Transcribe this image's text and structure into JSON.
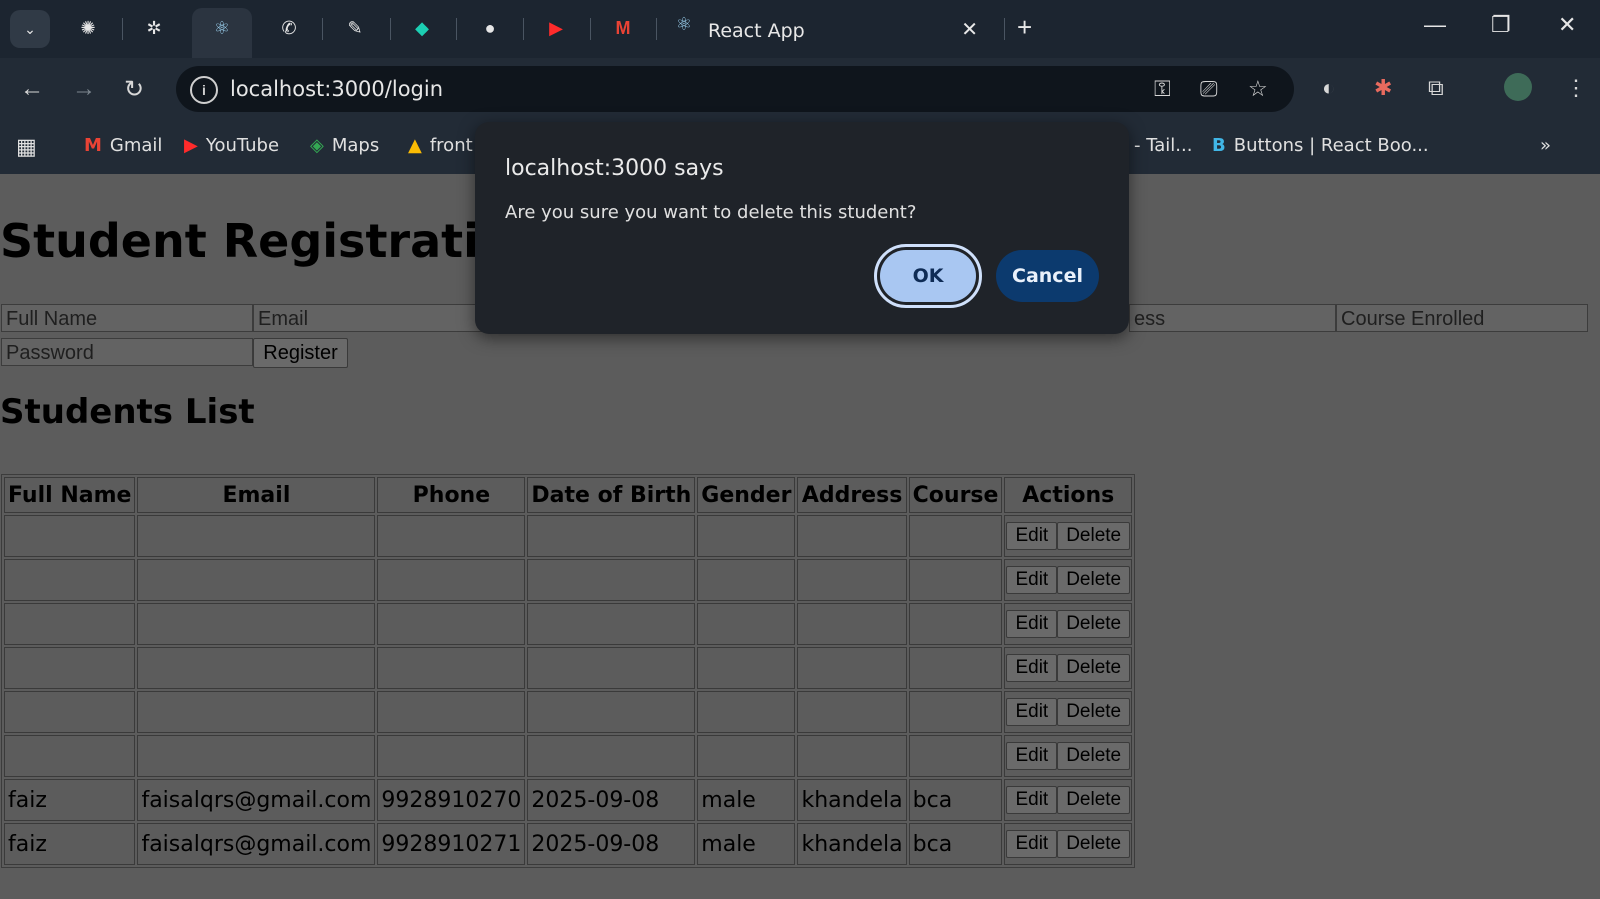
{
  "browser": {
    "active_tab_title": "React App",
    "url": "localhost:3000/login",
    "bookmarks": [
      "Gmail",
      "YouTube",
      "Maps",
      "front",
      "- Tail...",
      "Buttons | React Boo..."
    ]
  },
  "page": {
    "title": "Student Registration",
    "form": {
      "full_name_placeholder": "Full Name",
      "email_placeholder": "Email",
      "address_placeholder": "ess",
      "course_placeholder": "Course Enrolled",
      "password_placeholder": "Password",
      "register_label": "Register"
    },
    "list_title": "Students List",
    "table": {
      "headers": [
        "Full Name",
        "Email",
        "Phone",
        "Date of Birth",
        "Gender",
        "Address",
        "Course",
        "Actions"
      ],
      "rows": [
        [
          "",
          "",
          "",
          "",
          "",
          "",
          ""
        ],
        [
          "",
          "",
          "",
          "",
          "",
          "",
          ""
        ],
        [
          "",
          "",
          "",
          "",
          "",
          "",
          ""
        ],
        [
          "",
          "",
          "",
          "",
          "",
          "",
          ""
        ],
        [
          "",
          "",
          "",
          "",
          "",
          "",
          ""
        ],
        [
          "",
          "",
          "",
          "",
          "",
          "",
          ""
        ],
        [
          "faiz",
          "faisalqrs@gmail.com",
          "9928910270",
          "2025-09-08",
          "male",
          "khandela",
          "bca"
        ],
        [
          "faiz",
          "faisalqrs@gmail.com",
          "9928910271",
          "2025-09-08",
          "male",
          "khandela",
          "bca"
        ]
      ],
      "edit_label": "Edit",
      "delete_label": "Delete"
    }
  },
  "dialog": {
    "title": "localhost:3000 says",
    "message": "Are you sure you want to delete this student?",
    "ok_label": "OK",
    "cancel_label": "Cancel"
  }
}
